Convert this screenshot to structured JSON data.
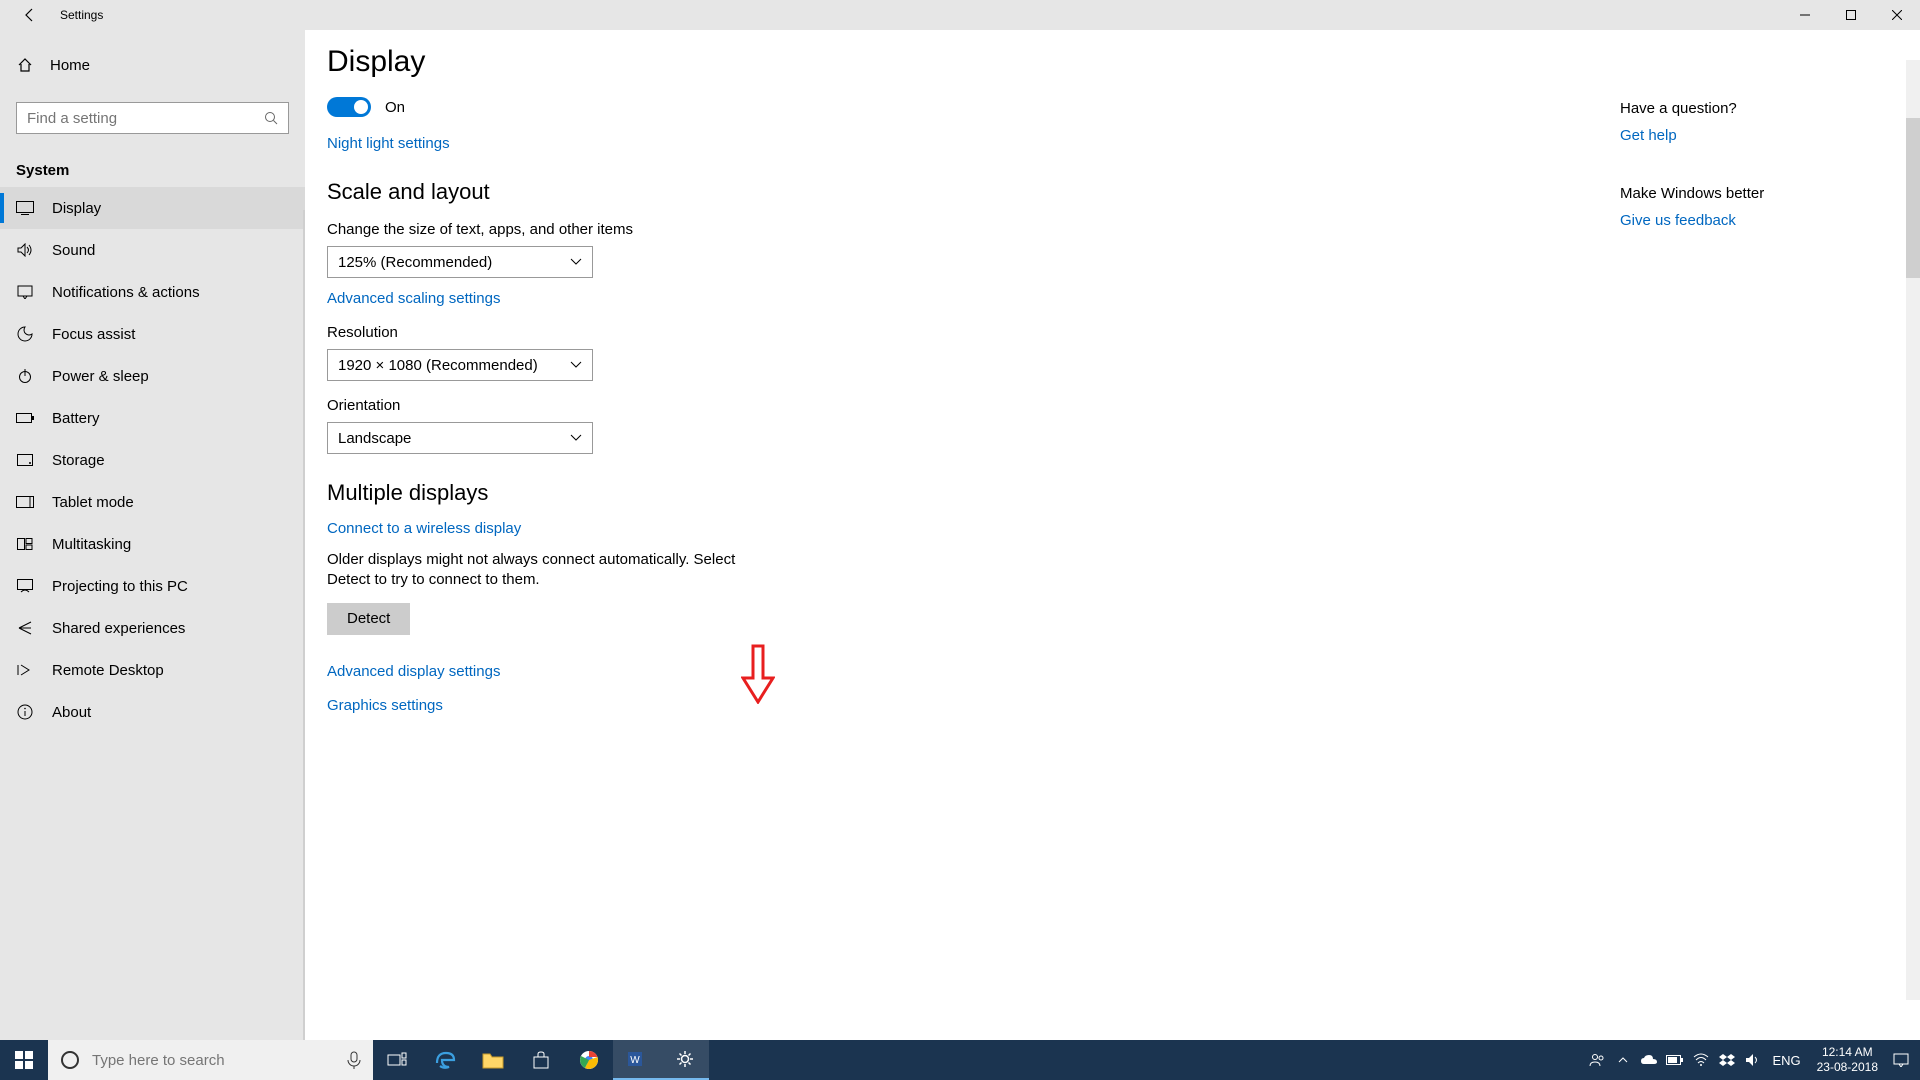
{
  "window": {
    "title": "Settings"
  },
  "sidebar": {
    "home": "Home",
    "search_placeholder": "Find a setting",
    "group": "System",
    "items": [
      {
        "label": "Display"
      },
      {
        "label": "Sound"
      },
      {
        "label": "Notifications & actions"
      },
      {
        "label": "Focus assist"
      },
      {
        "label": "Power & sleep"
      },
      {
        "label": "Battery"
      },
      {
        "label": "Storage"
      },
      {
        "label": "Tablet mode"
      },
      {
        "label": "Multitasking"
      },
      {
        "label": "Projecting to this PC"
      },
      {
        "label": "Shared experiences"
      },
      {
        "label": "Remote Desktop"
      },
      {
        "label": "About"
      }
    ]
  },
  "main": {
    "page_title": "Display",
    "toggle_state": "On",
    "night_light_link": "Night light settings",
    "scale_heading": "Scale and layout",
    "scale_label": "Change the size of text, apps, and other items",
    "scale_value": "125% (Recommended)",
    "advanced_scaling_link": "Advanced scaling settings",
    "resolution_label": "Resolution",
    "resolution_value": "1920 × 1080 (Recommended)",
    "orientation_label": "Orientation",
    "orientation_value": "Landscape",
    "multi_heading": "Multiple displays",
    "wireless_link": "Connect to a wireless display",
    "detect_hint": "Older displays might not always connect automatically. Select Detect to try to connect to them.",
    "detect_button": "Detect",
    "advanced_display_link": "Advanced display settings",
    "graphics_link": "Graphics settings"
  },
  "right_rail": {
    "question": "Have a question?",
    "get_help": "Get help",
    "improve": "Make Windows better",
    "feedback": "Give us feedback"
  },
  "taskbar": {
    "cortana_placeholder": "Type here to search",
    "lang": "ENG",
    "time": "12:14 AM",
    "date": "23-08-2018"
  },
  "colors": {
    "accent": "#0078d7",
    "link": "#0067c0",
    "annotation": "#e81f1f"
  }
}
